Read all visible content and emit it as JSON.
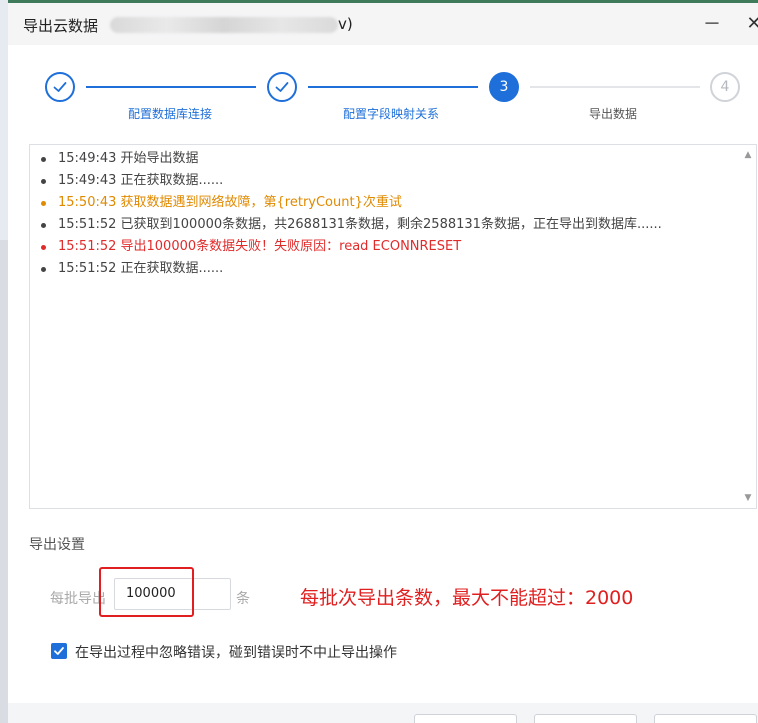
{
  "window": {
    "title": "导出云数据",
    "title_suffix": "v)",
    "minimize_glyph": "－",
    "close_glyph": "✕"
  },
  "steps": [
    {
      "number": "1",
      "label": "配置数据库连接",
      "state": "done"
    },
    {
      "number": "2",
      "label": "配置字段映射关系",
      "state": "done"
    },
    {
      "number": "3",
      "label": "导出数据",
      "state": "active"
    },
    {
      "number": "4",
      "label": "",
      "state": "todo"
    }
  ],
  "log": [
    {
      "text": "15:49:43 开始导出数据",
      "level": "info"
    },
    {
      "text": "15:49:43 正在获取数据......",
      "level": "info"
    },
    {
      "text": "15:50:43 获取数据遇到网络故障，第{retryCount}次重试",
      "level": "warn"
    },
    {
      "text": "15:51:52 已获取到100000条数据，共2688131条数据，剩余2588131条数据，正在导出到数据库......",
      "level": "info"
    },
    {
      "text": "15:51:52 导出100000条数据失败！失败原因：read ECONNRESET",
      "level": "error"
    },
    {
      "text": "15:51:52 正在获取数据......",
      "level": "info"
    }
  ],
  "settings": {
    "section_title": "导出设置",
    "batch_label": "每批导出",
    "batch_value": "100000",
    "unit_label": "条",
    "annotation": "每批次导出条数，最大不能超过：2000",
    "ignore_errors_label": "在导出过程中忽略错误，碰到错误时不中止导出操作",
    "ignore_errors_checked": true
  },
  "colors": {
    "accent": "#1e6fd9",
    "warn": "#e08a00",
    "error": "#e02b2b",
    "annotation": "#e02020"
  }
}
